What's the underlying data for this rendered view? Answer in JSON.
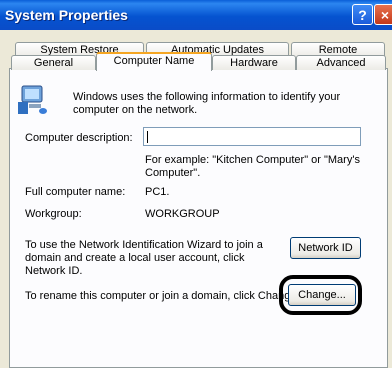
{
  "window": {
    "title": "System Properties",
    "help_glyph": "?",
    "close_glyph": "×"
  },
  "tabs_back": [
    "System Restore",
    "Automatic Updates",
    "Remote"
  ],
  "tabs_front": [
    "General",
    "Computer Name",
    "Hardware",
    "Advanced"
  ],
  "active_tab": "Computer Name",
  "panel": {
    "intro": "Windows uses the following information to identify your computer on the network.",
    "description_label": "Computer description:",
    "description_value": "",
    "example": "For example: \"Kitchen Computer\" or \"Mary's Computer\".",
    "fullname_label": "Full computer name:",
    "fullname_value": "PC1.",
    "workgroup_label": "Workgroup:",
    "workgroup_value": "WORKGROUP",
    "wizard_text": "To use the Network Identification Wizard to join a domain and create a local user account, click Network ID.",
    "network_id_button": "Network ID",
    "rename_text": "To rename this computer or join a domain, click Change.",
    "change_button": "Change..."
  },
  "colors": {
    "titlebar": "#0553D0",
    "dialog_bg": "#ECE9D8",
    "panel_bg": "#FCFCFE",
    "active_tab_accent": "#F5A623"
  }
}
